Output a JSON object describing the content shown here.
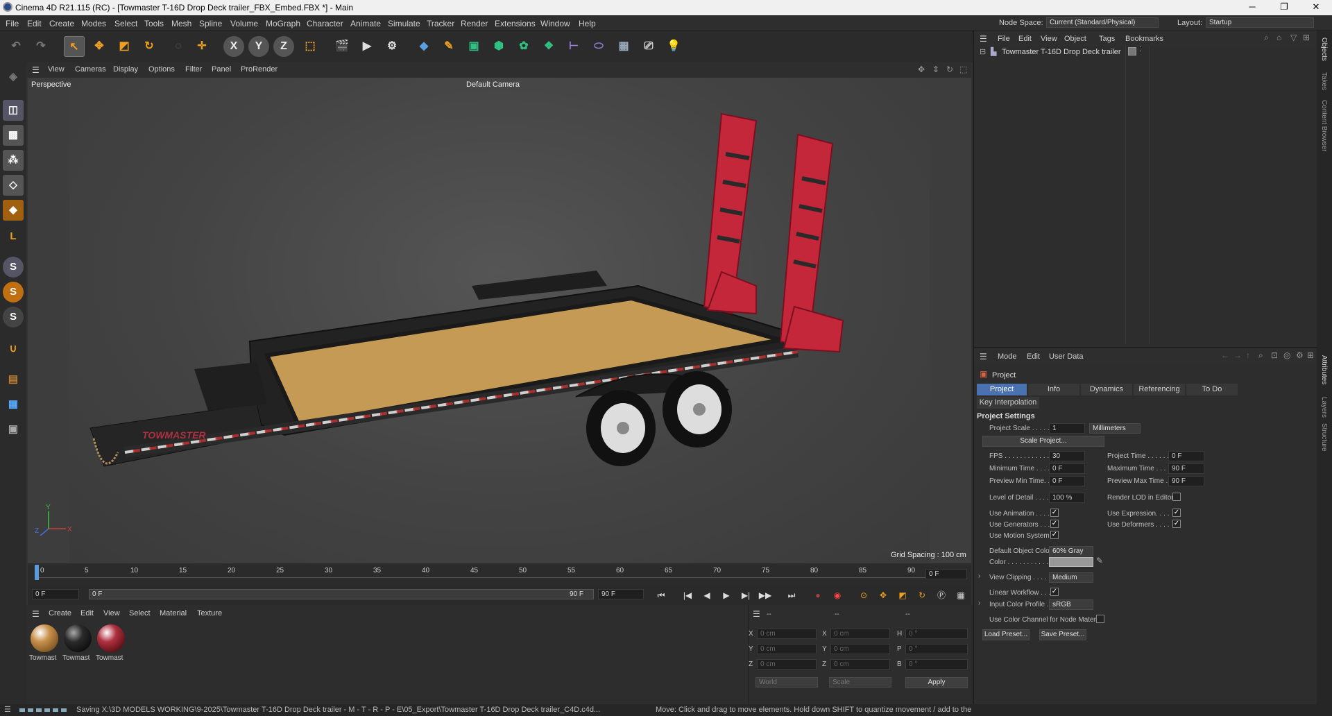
{
  "window": {
    "title": "Cinema 4D R21.115 (RC) - [Towmaster T-16D Drop Deck trailer_FBX_Embed.FBX *] - Main",
    "min": "─",
    "max": "❐",
    "close": "✕"
  },
  "menu": [
    "File",
    "Edit",
    "Create",
    "Modes",
    "Select",
    "Tools",
    "Mesh",
    "Spline",
    "Volume",
    "MoGraph",
    "Character",
    "Animate",
    "Simulate",
    "Tracker",
    "Render",
    "Extensions",
    "Window",
    "Help"
  ],
  "nodespace": {
    "label": "Node Space:",
    "value": "Current (Standard/Physical)"
  },
  "layout": {
    "label": "Layout:",
    "value": "Startup"
  },
  "toolbar": {
    "x": "X",
    "y": "Y",
    "z": "Z"
  },
  "lefttools": {
    "s1": "S",
    "s2": "S",
    "s3": "S",
    "l": "L"
  },
  "viewport": {
    "menu": [
      "View",
      "Cameras",
      "Display",
      "Options",
      "Filter",
      "Panel",
      "ProRender"
    ],
    "label": "Perspective",
    "camera": "Default Camera",
    "grid": "Grid Spacing : 100 cm",
    "axis_x": "X",
    "axis_y": "Y",
    "axis_z": "Z",
    "brand": "TOWMASTER"
  },
  "timeline": {
    "ticks": [
      "0",
      "5",
      "10",
      "15",
      "20",
      "25",
      "30",
      "35",
      "40",
      "45",
      "50",
      "55",
      "60",
      "65",
      "70",
      "75",
      "80",
      "85",
      "90"
    ],
    "frame": "0 F"
  },
  "playbar": {
    "start": "0 F",
    "current": "0 F",
    "end_marker": "90 F",
    "end": "90 F"
  },
  "materials": {
    "menu": [
      "Create",
      "Edit",
      "View",
      "Select",
      "Material",
      "Texture"
    ],
    "items": [
      {
        "label": "Towmast",
        "color": "#c8904a"
      },
      {
        "label": "Towmast",
        "color": "#2a2a2a"
      },
      {
        "label": "Towmast",
        "color": "#b03040"
      }
    ]
  },
  "coords": {
    "header1": "--",
    "header2": "--",
    "header3": "--",
    "rows": [
      {
        "a": "X",
        "av": "0 cm",
        "b": "X",
        "bv": "0 cm",
        "c": "H",
        "cv": "0 °"
      },
      {
        "a": "Y",
        "av": "0 cm",
        "b": "Y",
        "bv": "0 cm",
        "c": "P",
        "cv": "0 °"
      },
      {
        "a": "Z",
        "av": "0 cm",
        "b": "Z",
        "bv": "0 cm",
        "c": "B",
        "cv": "0 °"
      }
    ],
    "world": "World",
    "scale": "Scale",
    "apply": "Apply"
  },
  "status": {
    "left": "Saving X:\\3D MODELS WORKING\\9-2025\\Towmaster T-16D Drop Deck trailer - M - T - R - P - E\\05_Export\\Towmaster T-16D Drop Deck trailer_C4D.c4d...",
    "right": "Move: Click and drag to move elements. Hold down SHIFT to quantize movement / add to the"
  },
  "objects": {
    "menu": [
      "File",
      "Edit",
      "View",
      "Object",
      "Tags",
      "Bookmarks"
    ],
    "item": "Towmaster T-16D Drop Deck trailer"
  },
  "rightstrip": [
    "Objects",
    "Takes",
    "Content Browser",
    "Attributes",
    "Layers",
    "Structure"
  ],
  "attributes": {
    "menu": [
      "Mode",
      "Edit",
      "User Data"
    ],
    "title": "Project",
    "tabs": [
      "Project Settings",
      "Info",
      "Dynamics",
      "Referencing",
      "To Do"
    ],
    "tab2": "Key Interpolation",
    "section": "Project Settings",
    "project_scale": {
      "label": "Project Scale . . . . . .",
      "value": "1",
      "unit": "Millimeters"
    },
    "scale_btn": "Scale Project...",
    "fps": {
      "label": "FPS . . . . . . . . . . . . .",
      "value": "30"
    },
    "project_time": {
      "label": "Project Time . . . . . .",
      "value": "0 F"
    },
    "min_time": {
      "label": "Minimum Time . . . . .",
      "value": "0 F"
    },
    "max_time": {
      "label": "Maximum Time . . . .",
      "value": "90 F"
    },
    "prev_min": {
      "label": "Preview Min Time. . .",
      "value": "0 F"
    },
    "prev_max": {
      "label": "Preview Max Time . .",
      "value": "90 F"
    },
    "lod": {
      "label": "Level of Detail . . . . .",
      "value": "100 %"
    },
    "render_lod": {
      "label": "Render LOD in Editor"
    },
    "use_anim": {
      "label": "Use Animation . . . ."
    },
    "use_expr": {
      "label": "Use Expression. . . ."
    },
    "use_gen": {
      "label": "Use Generators . . . ."
    },
    "use_def": {
      "label": "Use Deformers . . . ."
    },
    "use_motion": {
      "label": "Use Motion System"
    },
    "def_color": {
      "label": "Default Object Color",
      "value": "60% Gray"
    },
    "color": {
      "label": "Color . . . . . . . . . . ."
    },
    "clipping": {
      "label": "View Clipping . . . . .",
      "value": "Medium"
    },
    "linear": {
      "label": "Linear Workflow . . . ."
    },
    "profile": {
      "label": "Input Color Profile . .",
      "value": "sRGB"
    },
    "node_mat": {
      "label": "Use Color Channel for Node Material"
    },
    "load": "Load Preset...",
    "save": "Save Preset...",
    "check": "✓"
  }
}
